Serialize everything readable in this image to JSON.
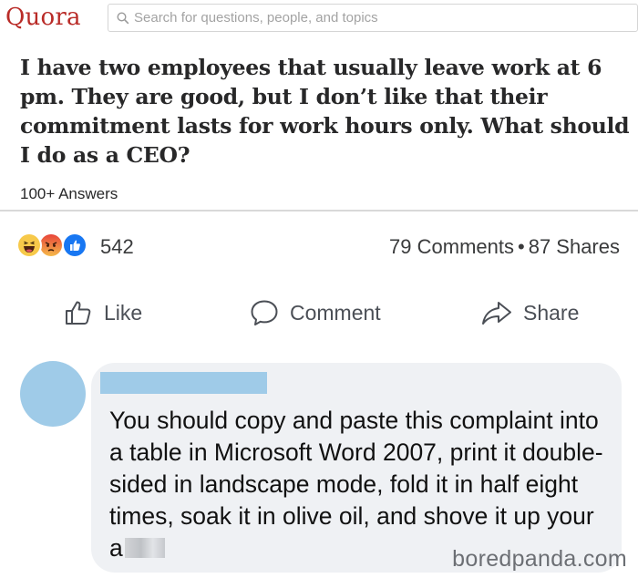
{
  "quora": {
    "logo": "Quora",
    "search": {
      "placeholder": "Search for questions, people, and topics"
    },
    "question": "I have two employees that usually leave work at 6 pm. They are good, but I don’t like that their commitment lasts for work hours only. What should I do as a CEO?",
    "answers_count": "100+ Answers"
  },
  "facebook": {
    "reactions": {
      "icons": [
        "haha-icon",
        "angry-icon",
        "like-reaction-icon"
      ],
      "count": "542"
    },
    "stats": {
      "comments": "79 Comments",
      "separator": "•",
      "shares": "87 Shares"
    },
    "actions": {
      "like": "Like",
      "comment": "Comment",
      "share": "Share"
    },
    "comment": {
      "text": "You should copy and paste this complaint into a table in Microsoft Word 2007, print it double-sided in landscape mode, fold it in half eight times, soak it in olive oil, and shove it up your a"
    }
  },
  "watermark": "boredpanda.com",
  "colors": {
    "quora_red": "#b92b27",
    "fb_blue": "#1877f2",
    "avatar_blue": "#9fcbe8",
    "bubble_bg": "#eff1f4"
  }
}
